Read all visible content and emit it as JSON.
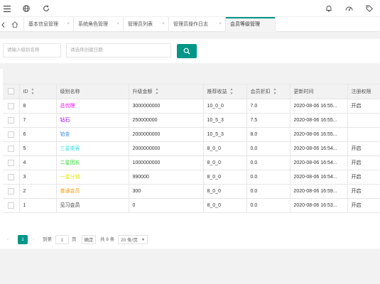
{
  "tabs": [
    {
      "label": "基本信息管理",
      "active": false
    },
    {
      "label": "系统角色管理",
      "active": false
    },
    {
      "label": "管理员列表",
      "active": false
    },
    {
      "label": "管理员操作日志",
      "active": false
    },
    {
      "label": "会员等级管理",
      "active": true
    }
  ],
  "tab_close_glyph": "×",
  "search": {
    "name_placeholder": "请输入级别名称",
    "date_placeholder": "请选择创建日期"
  },
  "table": {
    "columns": [
      "ID",
      "级别名称",
      "升级金额",
      "推荐收益",
      "会员折扣",
      "更新时间",
      "注册权限"
    ],
    "rows": [
      {
        "id": "8",
        "name": "总代理",
        "name_color": "#ff00ff",
        "amount": "3000000000",
        "reward": "10_0_0",
        "discount": "7.0",
        "updated": "2020-08-06 16:55...",
        "perm": "开启"
      },
      {
        "id": "7",
        "name": "钻石",
        "name_color": "#9900ff",
        "amount": "250000000",
        "reward": "10_5_3",
        "discount": "7.5",
        "updated": "2020-08-06 16:55...",
        "perm": ""
      },
      {
        "id": "6",
        "name": "铂金",
        "name_color": "#3d8fd9",
        "amount": "2000000000",
        "reward": "10_5_3",
        "discount": "8.0",
        "updated": "2020-08-06 16:55...",
        "perm": ""
      },
      {
        "id": "5",
        "name": "三星渠客",
        "name_color": "#33e0e0",
        "amount": "2000000000",
        "reward": "8_0_0",
        "discount": "0.0",
        "updated": "2020-08-06 16:54...",
        "perm": "开启"
      },
      {
        "id": "4",
        "name": "二星团长",
        "name_color": "#33d633",
        "amount": "1000000000",
        "reward": "8_0_0",
        "discount": "0.0",
        "updated": "2020-08-06 16:54...",
        "perm": "开启"
      },
      {
        "id": "3",
        "name": "一星分销",
        "name_color": "#e6e600",
        "amount": "990000",
        "reward": "8_0_0",
        "discount": "0.0",
        "updated": "2020-08-06 16:54...",
        "perm": "开启"
      },
      {
        "id": "2",
        "name": "普通会员",
        "name_color": "#ff9900",
        "amount": "300",
        "reward": "8_0_0",
        "discount": "0.0",
        "updated": "2020-08-06 16:59...",
        "perm": "开启"
      },
      {
        "id": "1",
        "name": "见习会员",
        "name_color": "#333333",
        "amount": "0",
        "reward": "8_0_0",
        "discount": "0.0",
        "updated": "2020-08-06 16:53...",
        "perm": "开启"
      }
    ]
  },
  "pager": {
    "current_page": "1",
    "goto_label": "到第",
    "goto_value": "1",
    "page_unit": "页",
    "confirm_label": "确定",
    "total_label": "共 8 条",
    "page_size": "20 条/页"
  },
  "colors": {
    "accent": "#009688"
  }
}
